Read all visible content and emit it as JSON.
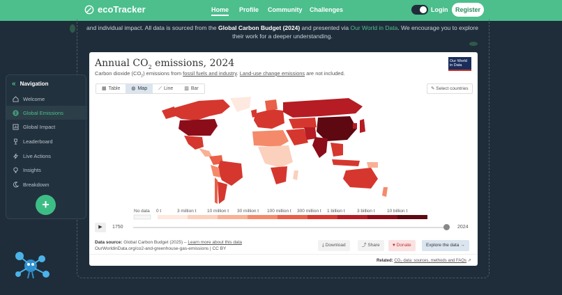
{
  "nav": {
    "brand": "ecoTracker",
    "links": [
      "Home",
      "Profile",
      "Community",
      "Challenges"
    ],
    "login": "Login",
    "register": "Register"
  },
  "intro": {
    "text_1": "and individual impact. All data is sourced from the",
    "bold": "Global Carbon Budget (2024)",
    "text_2": "and presented via",
    "link": "Our World in Data",
    "text_3": ". We encourage you to explore their work for a deeper understanding."
  },
  "sidebar": {
    "title": "Navigation",
    "items": [
      {
        "label": "Welcome",
        "icon": "home-icon",
        "active": false
      },
      {
        "label": "Global Emissions",
        "icon": "globe-icon",
        "active": true
      },
      {
        "label": "Global Impact",
        "icon": "chart-icon",
        "active": false
      },
      {
        "label": "Leaderboard",
        "icon": "trophy-icon",
        "active": false
      },
      {
        "label": "Live Actions",
        "icon": "bolt-icon",
        "active": false
      },
      {
        "label": "Insights",
        "icon": "bulb-icon",
        "active": false
      },
      {
        "label": "Breakdown",
        "icon": "pie-icon",
        "active": false
      }
    ],
    "fab": "+"
  },
  "card": {
    "title_pre": "Annual CO",
    "title_sub": "2",
    "title_post": " emissions, 2024",
    "subtitle_pre": "Carbon dioxide (CO",
    "subtitle_sub": "2",
    "subtitle_mid": ") emissions from",
    "subtitle_link1": "fossil fuels and industry",
    "subtitle_mid2": ".",
    "subtitle_link2": "Land-use change emissions",
    "subtitle_post": "are not included.",
    "logo_line1": "Our World",
    "logo_line2": "in Data",
    "tabs": [
      "Table",
      "Map",
      "Line",
      "Bar"
    ],
    "active_tab": "Map",
    "select_countries": "Select countries",
    "legend": {
      "no_data": "No data",
      "labels": [
        "0 t",
        "3 million t",
        "10 million t",
        "30 million t",
        "100 million t",
        "300 million t",
        "1 billion t",
        "3 billion t",
        "10 billion t"
      ],
      "colors": [
        "#fde9e0",
        "#fbd0bd",
        "#f8b195",
        "#f48a6a",
        "#e95f47",
        "#d5372e",
        "#b51c23",
        "#8c0d1a",
        "#5e0811"
      ]
    },
    "timeline": {
      "start": "1750",
      "end": "2024"
    },
    "source_label": "Data source:",
    "source": "Global Carbon Budget (2025)",
    "learn_more": "Learn more about this data",
    "url": "OurWorldinData.org/co2-and-greenhouse-gas-emissions | CC BY",
    "buttons": {
      "download": "Download",
      "share": "Share",
      "donate": "Donate",
      "explore": "Explore the data"
    },
    "related_label": "Related:",
    "related_link": "CO₂ data: sources, methods and FAQs"
  }
}
